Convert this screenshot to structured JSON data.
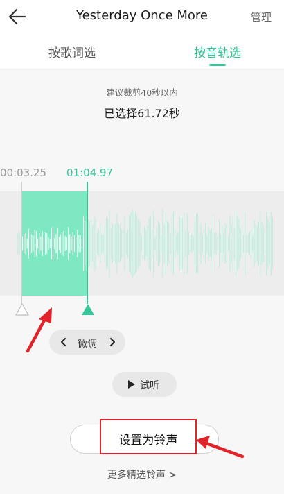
{
  "header": {
    "title": "Yesterday Once More",
    "manage_label": "管理",
    "back_icon": "arrow-left-icon"
  },
  "tabs": [
    {
      "label": "按歌词选",
      "active": false
    },
    {
      "label": "按音轨选",
      "active": true
    }
  ],
  "info": {
    "hint": "建议裁剪40秒以内",
    "selected_text": "已选择61.72秒"
  },
  "selection": {
    "start_time": "00:03.25",
    "end_time": "01:04.97"
  },
  "finetune": {
    "label": "微调"
  },
  "preview": {
    "label": "试听"
  },
  "set_ringtone": {
    "label": "设置为铃声"
  },
  "more_link": {
    "label": "更多精选铃声 >"
  },
  "colors": {
    "accent": "#35c79a",
    "selection_fill": "#7ee8c2",
    "annotation": "#e0242a"
  }
}
